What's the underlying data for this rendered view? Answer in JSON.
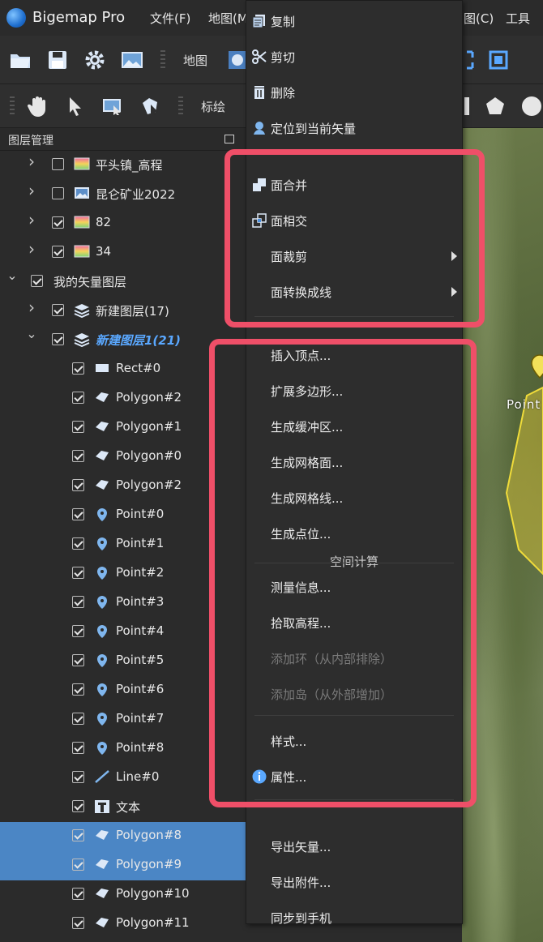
{
  "app": {
    "title": "Bigemap Pro"
  },
  "menubar": [
    {
      "label": "文件(F)"
    },
    {
      "label": "地图(M"
    },
    {
      "label": "图(C)"
    },
    {
      "label": "工具"
    }
  ],
  "toolbar1": {
    "map_label": "地图"
  },
  "toolbar2": {
    "annotate_label": "标绘"
  },
  "panel": {
    "title": "图层管理"
  },
  "layers": [
    {
      "label": "平头镇_高程",
      "checked": false,
      "expand": ">",
      "icon": "raster-gradient-icon"
    },
    {
      "label": "昆仑矿业2022",
      "checked": false,
      "expand": ">",
      "icon": "image-layer-icon"
    },
    {
      "label": "82",
      "checked": true,
      "expand": ">",
      "icon": "raster-gradient-icon"
    },
    {
      "label": "34",
      "checked": true,
      "expand": ">",
      "icon": "raster-gradient-icon"
    },
    {
      "label": "我的矢量图层",
      "checked": true,
      "expand": "v",
      "icon": ""
    },
    {
      "label": "新建图层(17)",
      "checked": true,
      "expand": ">",
      "icon": "layers-stack-icon"
    },
    {
      "label": "新建图层1(21)",
      "checked": true,
      "expand": "v",
      "icon": "layers-stack-icon",
      "active": true
    },
    {
      "label": "Rect#0",
      "checked": true,
      "icon": "rect-icon"
    },
    {
      "label": "Polygon#2",
      "checked": true,
      "icon": "polygon-icon"
    },
    {
      "label": "Polygon#1",
      "checked": true,
      "icon": "polygon-icon"
    },
    {
      "label": "Polygon#0",
      "checked": true,
      "icon": "polygon-icon"
    },
    {
      "label": "Polygon#2",
      "checked": true,
      "icon": "polygon-icon"
    },
    {
      "label": "Point#0",
      "checked": true,
      "icon": "pin-icon"
    },
    {
      "label": "Point#1",
      "checked": true,
      "icon": "pin-icon"
    },
    {
      "label": "Point#2",
      "checked": true,
      "icon": "pin-icon"
    },
    {
      "label": "Point#3",
      "checked": true,
      "icon": "pin-icon"
    },
    {
      "label": "Point#4",
      "checked": true,
      "icon": "pin-icon"
    },
    {
      "label": "Point#5",
      "checked": true,
      "icon": "pin-icon"
    },
    {
      "label": "Point#6",
      "checked": true,
      "icon": "pin-icon"
    },
    {
      "label": "Point#7",
      "checked": true,
      "icon": "pin-icon"
    },
    {
      "label": "Point#8",
      "checked": true,
      "icon": "pin-icon"
    },
    {
      "label": "Line#0",
      "checked": true,
      "icon": "line-icon"
    },
    {
      "label": "文本",
      "checked": true,
      "icon": "text-icon"
    },
    {
      "label": "Polygon#8",
      "checked": true,
      "icon": "polygon-icon",
      "selected": true
    },
    {
      "label": "Polygon#9",
      "checked": true,
      "icon": "polygon-icon",
      "selected": true
    },
    {
      "label": "Polygon#10",
      "checked": true,
      "icon": "polygon-icon"
    },
    {
      "label": "Polygon#11",
      "checked": true,
      "icon": "polygon-icon"
    }
  ],
  "context_menu": {
    "items_top": [
      {
        "label": "复制",
        "icon": "copy-icon"
      },
      {
        "label": "剪切",
        "icon": "scissors-icon"
      },
      {
        "label": "删除",
        "icon": "trash-icon"
      },
      {
        "label": "定位到当前矢量",
        "icon": "locate-icon"
      }
    ],
    "group1": [
      {
        "label": "面合并",
        "icon": "union-icon"
      },
      {
        "label": "面相交",
        "icon": "intersect-icon"
      },
      {
        "label": "面裁剪",
        "submenu": true
      },
      {
        "label": "面转换成线",
        "submenu": true
      }
    ],
    "group2": [
      {
        "label": "插入顶点..."
      },
      {
        "label": "扩展多边形..."
      },
      {
        "label": "生成缓冲区..."
      },
      {
        "label": "生成网格面..."
      },
      {
        "label": "生成网格线..."
      },
      {
        "label": "生成点位..."
      }
    ],
    "section_spatial": "空间计算",
    "group3": [
      {
        "label": "测量信息..."
      },
      {
        "label": "拾取高程..."
      },
      {
        "label": "添加环（从内部排除）",
        "disabled": true
      },
      {
        "label": "添加岛（从外部增加）",
        "disabled": true
      }
    ],
    "group4": [
      {
        "label": "样式..."
      },
      {
        "label": "属性...",
        "icon": "info-icon"
      }
    ],
    "group5": [
      {
        "label": "导出矢量..."
      },
      {
        "label": "导出附件..."
      },
      {
        "label": "同步到手机"
      }
    ]
  },
  "map": {
    "point_label": "Point"
  },
  "colors": {
    "highlight": "#ef4f68",
    "selection": "#4b86c5",
    "active_layer": "#5aa8ff",
    "polygon_fill": "#e3c93a"
  }
}
